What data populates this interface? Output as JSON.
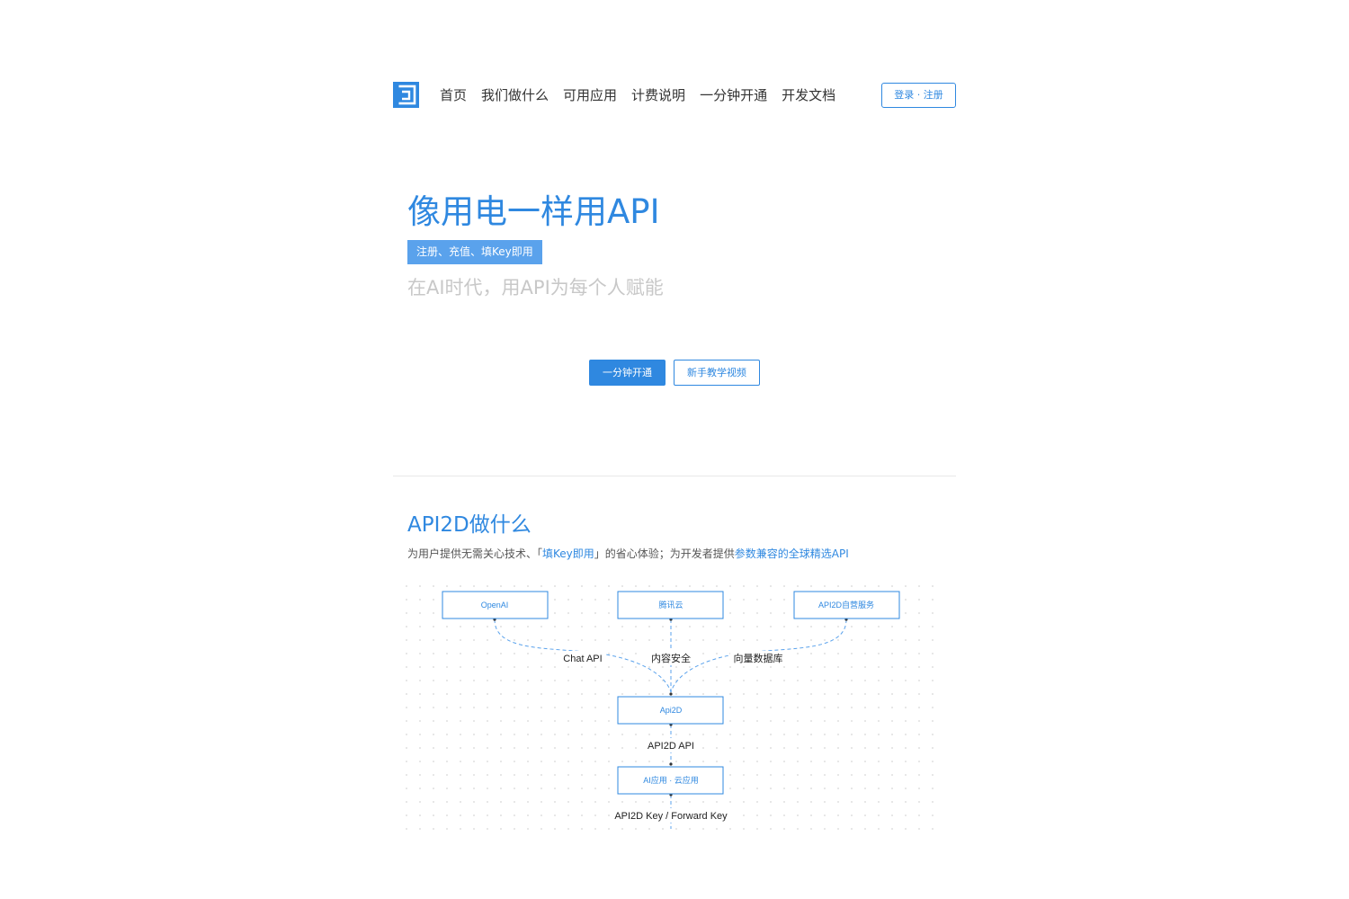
{
  "nav": {
    "items": [
      "首页",
      "我们做什么",
      "可用应用",
      "计费说明",
      "一分钟开通",
      "开发文档"
    ],
    "login_label": "登录 · 注册"
  },
  "hero": {
    "title": "像用电一样用API",
    "tag": "注册、充值、填Key即用",
    "subtitle": "在AI时代，用API为每个人赋能",
    "primary_button": "一分钟开通",
    "secondary_button": "新手教学视频"
  },
  "section": {
    "title": "API2D做什么",
    "desc_1": "为用户提供无需关心技术、「",
    "desc_hl_1": "填Key即用",
    "desc_2": "」的省心体验；为开发者提供",
    "desc_hl_2": "参数兼容的全球精选API"
  },
  "diagram": {
    "nodes": {
      "openai": "OpenAI",
      "tencent": "腾讯云",
      "selfhosted": "API2D自营服务",
      "api2d": "Api2D",
      "apps": "AI应用 · 云应用"
    },
    "edges": {
      "chat_api": "Chat API",
      "content_safety": "内容安全",
      "vector_db": "向量数据库",
      "api2d_api": "API2D API",
      "keys": "API2D Key / Forward Key"
    }
  },
  "colors": {
    "accent": "#2f88e0",
    "tag_bg": "#5aa2ec",
    "subtitle": "#c8c8c8"
  }
}
